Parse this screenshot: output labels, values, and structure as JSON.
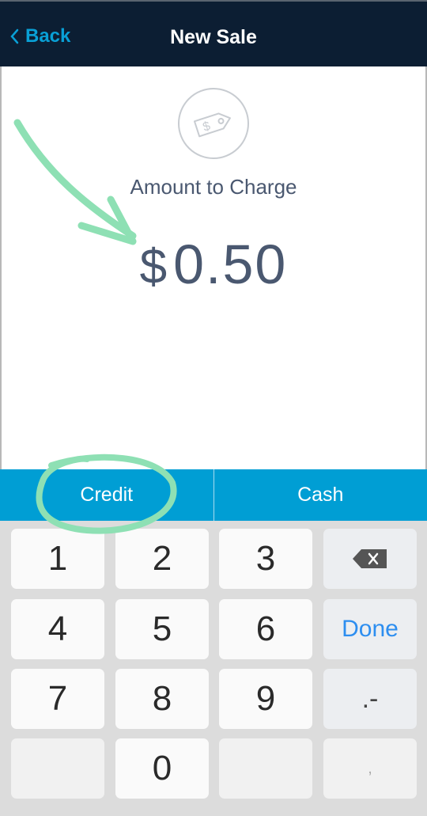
{
  "header": {
    "back_label": "Back",
    "title": "New Sale"
  },
  "main": {
    "icon": "price-tag-dollar-icon",
    "amount_label": "Amount to Charge",
    "currency": "$",
    "amount": "0.50"
  },
  "tabs": [
    {
      "label": "Credit"
    },
    {
      "label": "Cash"
    }
  ],
  "keypad": {
    "keys": [
      "1",
      "2",
      "3",
      "4",
      "5",
      "6",
      "7",
      "8",
      "9",
      "0"
    ],
    "done_label": "Done",
    "decimal_label": ".-",
    "comma_label": ","
  },
  "colors": {
    "header_bg": "#0c1e33",
    "accent": "#009ed4",
    "annotation": "#8ee0b4",
    "done": "#2d8ef0"
  }
}
